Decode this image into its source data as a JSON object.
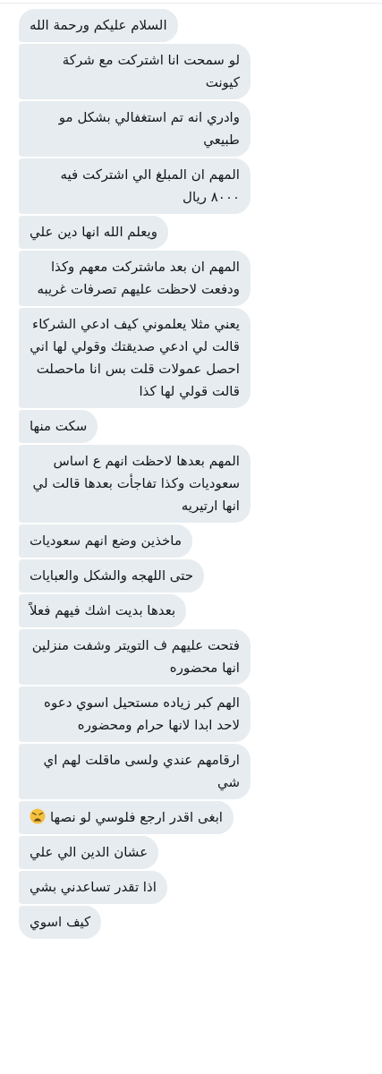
{
  "messages": [
    {
      "text": "السلام عليكم ورحمة الله"
    },
    {
      "text": "لو سمحت انا اشتركت مع شركة كيونت"
    },
    {
      "text": "وادري انه تم استغفالي بشكل مو طبيعي"
    },
    {
      "text": "المهم ان المبلغ الي اشتركت فيه ٨٠٠٠ ريال"
    },
    {
      "text": "ويعلم الله انها دين علي"
    },
    {
      "text": "المهم ان بعد ماشتركت معهم وكذا ودفعت لاحظت عليهم تصرفات غريبه"
    },
    {
      "text": "يعني مثلا يعلموني كيف ادعي الشركاء قالت لي ادعي صديقتك وقولي لها اني احصل عمولات قلت بس انا ماحصلت قالت قولي لها كذا"
    },
    {
      "text": "سكت منها"
    },
    {
      "text": "المهم بعدها لاحظت انهم ع اساس سعوديات وكذا تفاجأت بعدها قالت لي انها ارتيريه"
    },
    {
      "text": "ماخذين وضع انهم سعوديات"
    },
    {
      "text": "حتى اللهجه والشكل والعبايات"
    },
    {
      "text": "بعدها بديت اشك فيهم فعلاً"
    },
    {
      "text": "فتحت عليهم ف التويتر وشفت منزلين انها محضوره"
    },
    {
      "text": "الهم كبر زياده مستحيل اسوي دعوه لاحد ابدا لانها حرام ومحضوره"
    },
    {
      "text": "ارقامهم عندي ولسى ماقلت لهم اي شي"
    },
    {
      "text": "ابغى اقدر ارجع فلوسي لو نصها",
      "kind": "text-with-weary-face"
    },
    {
      "text": "عشان الدين الي علي"
    },
    {
      "text": "اذا تقدر تساعدني بشي"
    },
    {
      "text": "كيف اسوي"
    }
  ]
}
